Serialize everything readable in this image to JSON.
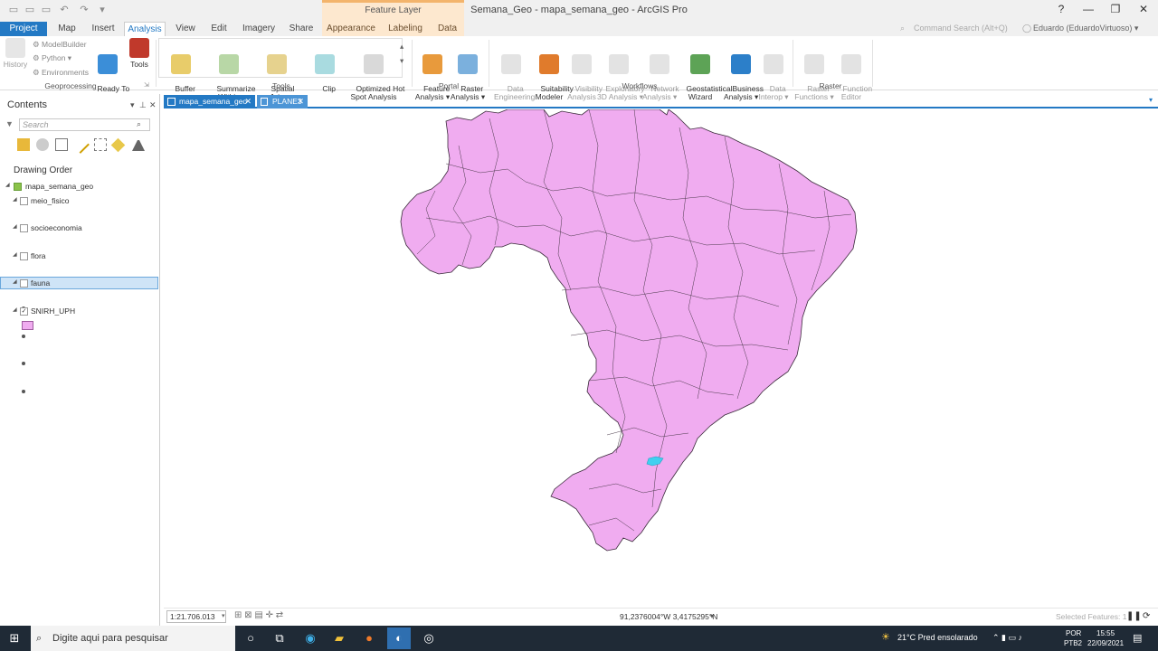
{
  "window": {
    "title": "Semana_Geo - mapa_semana_geo - ArcGIS Pro",
    "contextual_tab_group": "Feature Layer",
    "help": "?",
    "minimize": "—",
    "restore": "❐",
    "close": "✕"
  },
  "ribbon_tabs": [
    "Project",
    "Map",
    "Insert",
    "Analysis",
    "View",
    "Edit",
    "Imagery",
    "Share",
    "Appearance",
    "Labeling",
    "Data"
  ],
  "active_tab": "Analysis",
  "command_search": "Command Search (Alt+Q)",
  "user": "Eduardo (EduardoVirtuoso) ▾",
  "geoprocessing": {
    "history": "History",
    "modelbuilder": "ModelBuilder",
    "python": "Python ▾",
    "environments": "Environments",
    "ready_to_use": "Ready To\nUse Tools ▾",
    "tools": "Tools",
    "label": "Geoprocessing"
  },
  "tools_group": {
    "buttons": [
      "Buffer",
      "Summarize\nWithin",
      "Spatial\nJoin",
      "Clip",
      "Optimized Hot\nSpot Analysis"
    ],
    "label": "Tools"
  },
  "portal_group": {
    "buttons": [
      "Feature\nAnalysis ▾",
      "Raster\nAnalysis ▾"
    ],
    "label": "Portal"
  },
  "workflows_group": {
    "buttons": [
      "Data\nEngineering",
      "Suitability\nModeler",
      "Visibility\nAnalysis",
      "Exploratory\n3D Analysis ▾",
      "Network\nAnalysis ▾",
      "Geostatistical\nWizard",
      "Business\nAnalysis ▾",
      "Data\nInterop ▾"
    ],
    "label": "Workflows"
  },
  "raster_group": {
    "buttons": [
      "Raster\nFunctions ▾",
      "Function\nEditor"
    ],
    "label": "Raster"
  },
  "contents": {
    "title": "Contents",
    "search_placeholder": "Search",
    "drawing_order": "Drawing Order",
    "map_name": "mapa_semana_geo",
    "layers": [
      "meio_fisico",
      "socioeconomia",
      "flora",
      "fauna",
      "SNIRH_UPH"
    ]
  },
  "map_tabs": [
    "mapa_semana_geo",
    "PLANE3"
  ],
  "status": {
    "scale": "1:21.706.013",
    "coordinates": "91,2376004°W 3,4175295°N",
    "selected_features": "Selected Features: 1"
  },
  "taskbar": {
    "search_placeholder": "Digite aqui para pesquisar",
    "weather": "21°C  Pred ensolarado",
    "lang": "POR",
    "lang2": "PTB2",
    "time": "15:55",
    "date": "22/09/2021"
  },
  "colors": {
    "accent": "#2379c4",
    "polygon_fill": "#f0acf0",
    "selected_feature": "#40d0f0"
  }
}
